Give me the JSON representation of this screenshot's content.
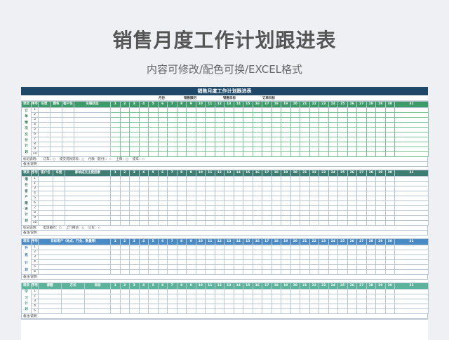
{
  "page": {
    "title": "销售月度工作计划跟进表",
    "subtitle": "内容可修改/配色可换/EXCEL格式"
  },
  "sheet": {
    "title": "销售月度工作计划跟进表",
    "month_label": "月份",
    "visits_label": "销售顾问",
    "sales_target_label": "销售目标",
    "order_target_label": "订单目标"
  },
  "days": [
    "1",
    "2",
    "3",
    "4",
    "5",
    "6",
    "7",
    "8",
    "9",
    "10",
    "11",
    "12",
    "13",
    "14",
    "15",
    "16",
    "17",
    "18",
    "19",
    "20",
    "21",
    "22",
    "23",
    "24",
    "25",
    "26",
    "27",
    "28",
    "29",
    "30",
    "31"
  ],
  "section1": {
    "headers": [
      "项目",
      "序号",
      "车型",
      "颜色",
      "客户名",
      "车辆状态"
    ],
    "vertical": [
      "订",
      "单",
      "情",
      "况",
      "交",
      "付",
      "计",
      "划"
    ],
    "rows": [
      "1",
      "2",
      "3",
      "4",
      "5",
      "6",
      "7",
      "8",
      "9",
      "10"
    ],
    "legend_label": "标记说明：",
    "legend_items": [
      "订车：○",
      "提交贷款资料：△",
      "付款（首付）：☆",
      "上牌：□",
      "提车：☆"
    ]
  },
  "section2": {
    "headers": [
      "项目",
      "序号",
      "客户名",
      "车型",
      "影响成交主要因素"
    ],
    "vertical": [
      "潜",
      "在",
      "客",
      "户",
      "跟",
      "进",
      "计",
      "划"
    ],
    "rows": [
      "1",
      "2",
      "3",
      "4",
      "5",
      "6",
      "7",
      "8",
      "9",
      "10"
    ],
    "legend_label": "标记说明：",
    "legend_items": [
      "电话邀约：○",
      "上门拜访：△",
      "订车：☆"
    ]
  },
  "section3": {
    "headers": [
      "项目",
      "序号",
      "目标客户（地点、行业、数量等）"
    ],
    "vertical": [
      "外",
      "拓",
      "计",
      "划"
    ],
    "rows": [
      "1",
      "2",
      "3",
      "4",
      "5",
      "6"
    ]
  },
  "section4": {
    "headers": [
      "项目",
      "序号",
      "课题",
      "方式",
      "目标"
    ],
    "vertical": [
      "学",
      "习",
      "计",
      "划"
    ],
    "rows": [
      "1",
      "2",
      "3",
      "4",
      "5"
    ]
  },
  "remark_label": "备注/说明"
}
